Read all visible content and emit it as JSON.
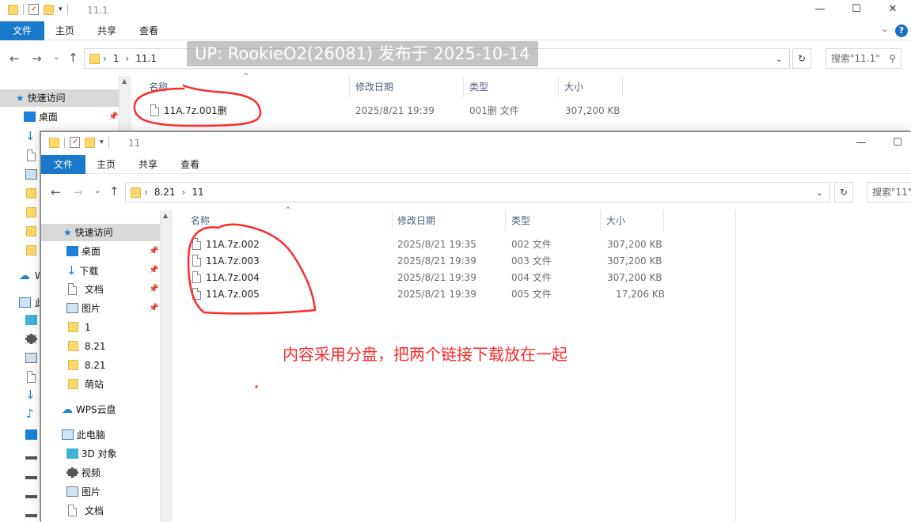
{
  "w1": {
    "title": "11.1",
    "tabs": [
      "文件",
      "主页",
      "共享",
      "查看"
    ],
    "breadcrumbs": [
      "1",
      "11.1"
    ],
    "search_placeholder": "搜索\"11.1\"",
    "nav_quick": "快速访问",
    "nav_desktop": "桌面",
    "nav_w_partial": "W",
    "nav_pc_partial": "此",
    "headers": {
      "name": "名称",
      "date": "修改日期",
      "type": "类型",
      "size": "大小"
    },
    "file": {
      "name": "11A.7z.001删",
      "date": "2025/8/21 19:39",
      "type": "001删 文件",
      "size": "307,200 KB"
    }
  },
  "overlay_text": "UP: RookieO2(26081) 发布于 2025-10-14",
  "w2": {
    "title": "11",
    "tabs": [
      "文件",
      "主页",
      "共享",
      "查看"
    ],
    "breadcrumbs": [
      "8.21",
      "11"
    ],
    "search_placeholder": "搜索\"11\"",
    "nav": {
      "quick": "快速访问",
      "desktop": "桌面",
      "downloads": "下载",
      "documents": "文档",
      "pictures": "图片",
      "f1": "1",
      "f821a": "8.21",
      "f821b": "8.21",
      "mengzhan": "萌站",
      "wps": "WPS云盘",
      "thispc": "此电脑",
      "obj3d": "3D 对象",
      "videos": "视频",
      "pictures2": "图片",
      "documents2": "文档"
    },
    "headers": {
      "name": "名称",
      "date": "修改日期",
      "type": "类型",
      "size": "大小"
    },
    "files": [
      {
        "name": "11A.7z.002",
        "date": "2025/8/21 19:35",
        "type": "002 文件",
        "size": "307,200 KB"
      },
      {
        "name": "11A.7z.003",
        "date": "2025/8/21 19:39",
        "type": "003 文件",
        "size": "307,200 KB"
      },
      {
        "name": "11A.7z.004",
        "date": "2025/8/21 19:39",
        "type": "004 文件",
        "size": "307,200 KB"
      },
      {
        "name": "11A.7z.005",
        "date": "2025/8/21 19:39",
        "type": "005 文件",
        "size": "17,206 KB"
      }
    ]
  },
  "annotation_note": "内容采用分盘，把两个链接下载放在一起",
  "colors": {
    "accent": "#1979ca",
    "ink": "#ff2a2a",
    "folder": "#ffd86b"
  }
}
